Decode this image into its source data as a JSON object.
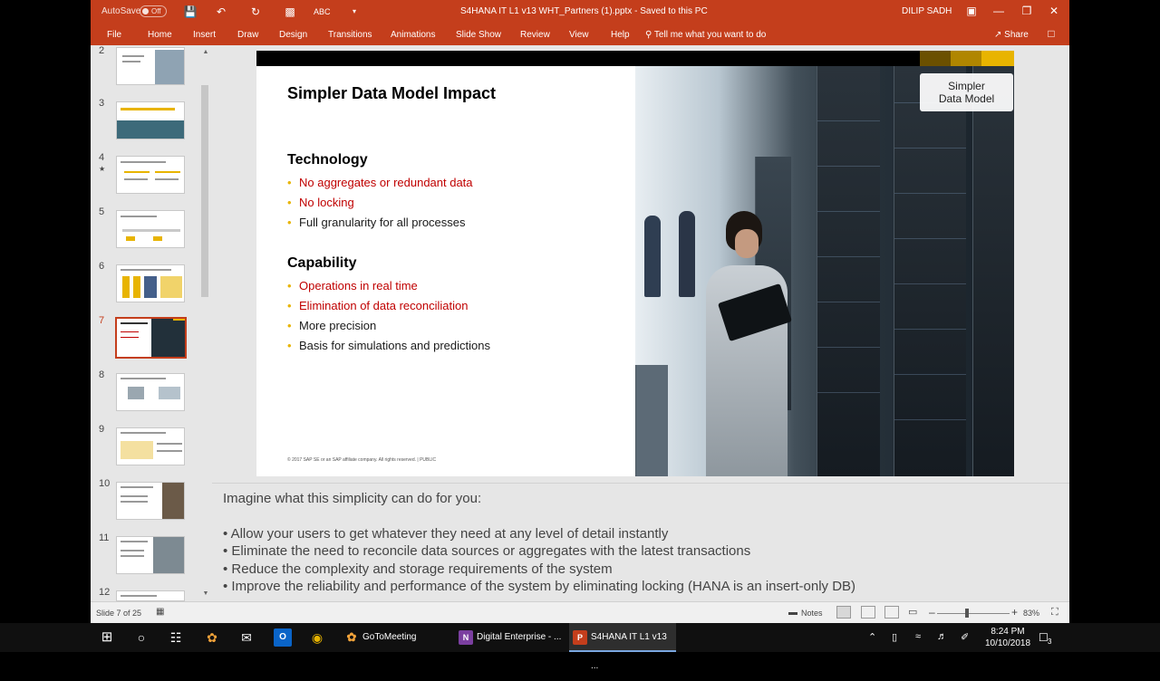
{
  "titlebar": {
    "autosave_label": "AutoSave",
    "autosave_state": "Off",
    "document_title": "S4HANA IT L1 v13 WHT_Partners (1).pptx  -  Saved to this PC",
    "user": "DILIP SADH"
  },
  "ribbon": {
    "tabs": [
      "File",
      "Home",
      "Insert",
      "Draw",
      "Design",
      "Transitions",
      "Animations",
      "Slide Show",
      "Review",
      "View",
      "Help"
    ],
    "tell_me": "Tell me what you want to do",
    "share": "Share"
  },
  "thumbnails": {
    "numbers": [
      "2",
      "3",
      "4",
      "5",
      "6",
      "7",
      "8",
      "9",
      "10",
      "11",
      "12"
    ],
    "active_index": 5
  },
  "slide": {
    "title": "Simpler Data Model Impact",
    "tag": "Simpler\nData Model",
    "sections": [
      {
        "heading": "Technology",
        "bullets": [
          {
            "text": "No aggregates or redundant data",
            "highlight": true
          },
          {
            "text": "No locking",
            "highlight": true
          },
          {
            "text": "Full granularity for all processes",
            "highlight": false
          }
        ]
      },
      {
        "heading": "Capability",
        "bullets": [
          {
            "text": "Operations in real time",
            "highlight": true
          },
          {
            "text": "Elimination of data reconciliation",
            "highlight": true
          },
          {
            "text": "More precision",
            "highlight": false
          },
          {
            "text": "Basis for simulations and predictions",
            "highlight": false
          }
        ]
      }
    ],
    "copyright": "© 2017 SAP SE or an SAP affiliate company. All rights reserved.  |  PUBLIC",
    "accent_color": "#c00000",
    "bullet_color": "#e8b400"
  },
  "notes": {
    "intro": "Imagine what this simplicity can do for you:",
    "lines": [
      "• Allow your users to get whatever they need at any level of detail instantly",
      "• Eliminate the need to reconcile data sources or aggregates with the latest transactions",
      "• Reduce the complexity and storage requirements of the system",
      "• Improve the reliability and performance of the system by eliminating locking (HANA is an insert-only DB)"
    ]
  },
  "status": {
    "slide_count": "Slide 7 of 25",
    "notes_label": "Notes",
    "zoom": "83%"
  },
  "taskbar": {
    "apps": [
      "GoToMeeting",
      "Digital Enterprise - ...",
      "S4HANA IT L1 v13 ..."
    ],
    "time": "8:24 PM",
    "date": "10/10/2018",
    "notification_count": "3"
  }
}
